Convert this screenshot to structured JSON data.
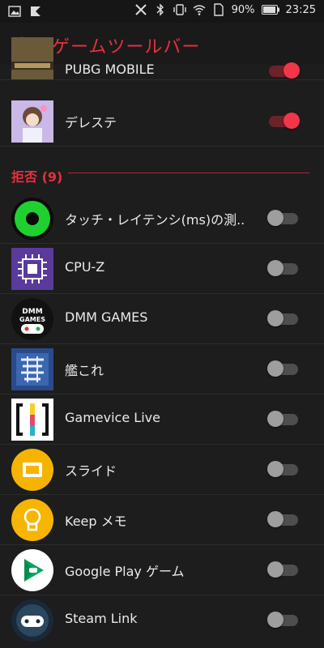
{
  "status_bar": {
    "battery": "90%",
    "time": "23:25",
    "icons": [
      "image-icon",
      "app-notification-icon",
      "x-icon",
      "bluetooth-icon",
      "vibrate-icon",
      "wifi-icon",
      "sim-icon",
      "battery-icon"
    ]
  },
  "header": {
    "title": "ゲームツールバー",
    "back_icon": "back-arrow-icon"
  },
  "colors": {
    "accent": "#e6303e",
    "background": "#1d1d1d",
    "toggle_on": "#f1364a",
    "toggle_off": "#9e9e9e"
  },
  "allowed_apps": [
    {
      "label": "PUBG MOBILE",
      "icon": "pubg-icon",
      "enabled": true
    },
    {
      "label": "デレステ",
      "icon": "deresute-icon",
      "enabled": true
    }
  ],
  "section": {
    "label": "拒否 (9)"
  },
  "denied_apps": [
    {
      "label": "タッチ・レイテンシ(ms)の測..",
      "icon": "touch-latency-icon",
      "enabled": false
    },
    {
      "label": "CPU-Z",
      "icon": "cpu-z-icon",
      "enabled": false
    },
    {
      "label": "DMM GAMES",
      "icon": "dmm-games-icon",
      "enabled": false,
      "icon_text": "DMM GAMES"
    },
    {
      "label": "艦これ",
      "icon": "kancolle-icon",
      "enabled": false
    },
    {
      "label": "Gamevice Live",
      "icon": "gamevice-icon",
      "enabled": false
    },
    {
      "label": "スライド",
      "icon": "slides-icon",
      "enabled": false
    },
    {
      "label": "Keep メモ",
      "icon": "keep-icon",
      "enabled": false
    },
    {
      "label": "Google Play ゲーム",
      "icon": "play-games-icon",
      "enabled": false
    },
    {
      "label": "Steam Link",
      "icon": "steam-link-icon",
      "enabled": false
    }
  ]
}
